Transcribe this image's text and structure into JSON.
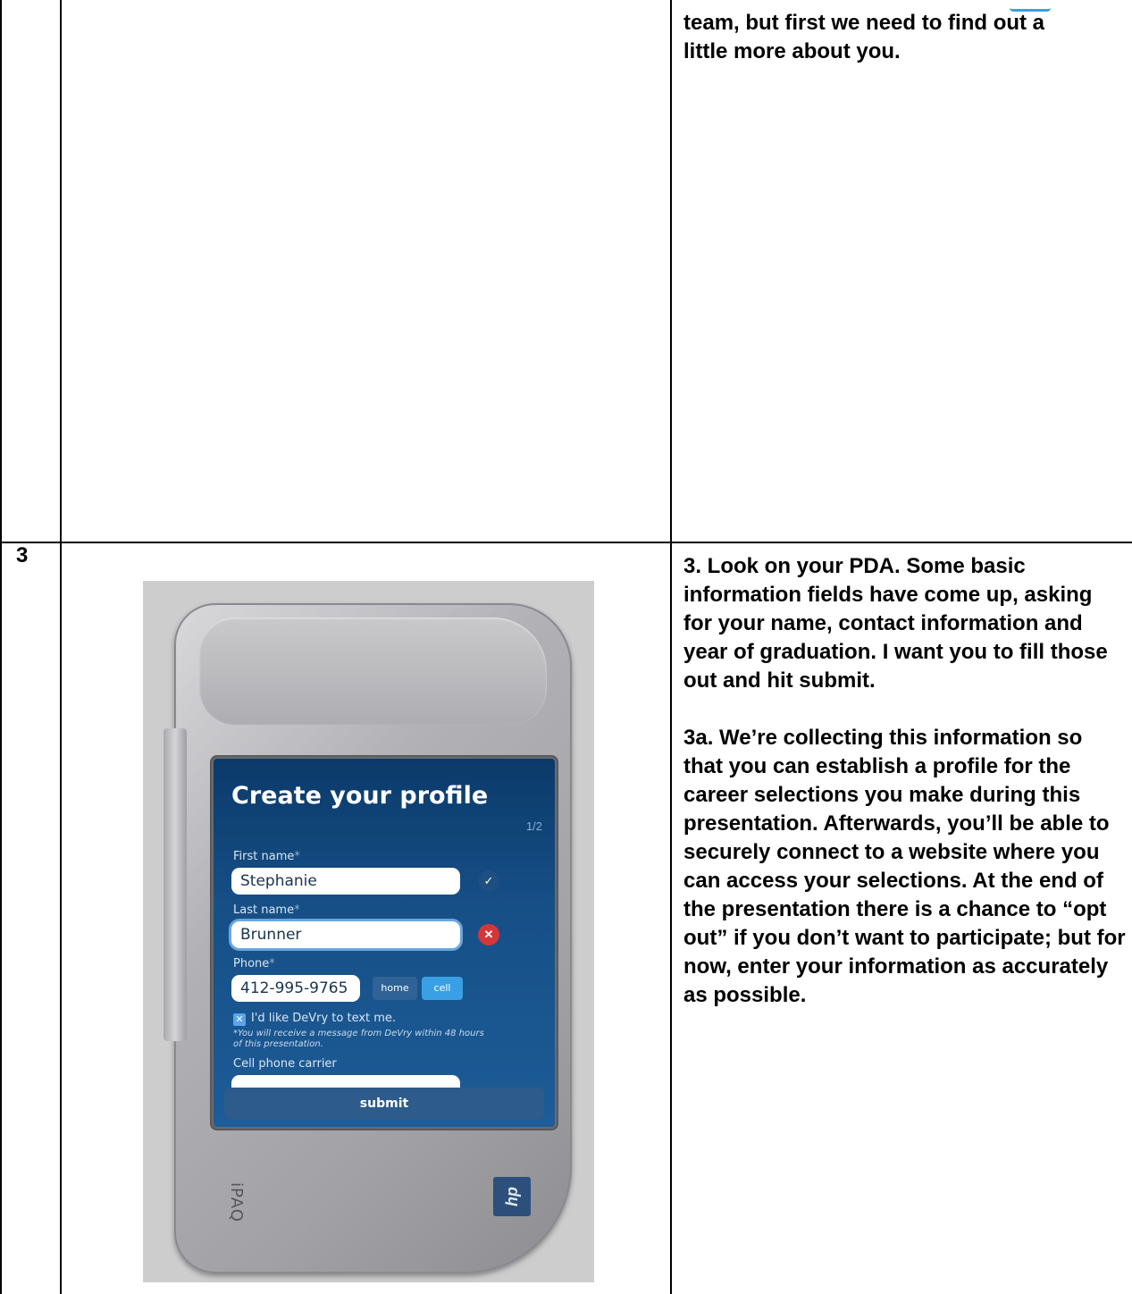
{
  "table": {
    "row2_notes": [
      "team, but first we need to find out a",
      "little more about you."
    ],
    "row3": {
      "step": "3",
      "notes": [
        "3. Look on your PDA. Some basic information fields have come up, asking for your name, contact information and year of graduation. I want you to fill those out and hit submit.",
        "3a. We’re collecting this information so that you can establish a profile for the career selections you make during this presentation. Afterwards, you’ll be able to securely connect to a website where you can access your selections. At the end of the presentation there is a chance to “opt out” if you don’t want to participate; but for now, enter your information as accurately as possible."
      ]
    }
  },
  "pda": {
    "title": "Create your profile",
    "page": "1/2",
    "first_name_label": "First name",
    "first_name_value": "Stephanie",
    "last_name_label": "Last name",
    "last_name_value": "Brunner",
    "phone_label": "Phone",
    "phone_value": "412-995-9765",
    "phone_home": "home",
    "phone_cell": "cell",
    "required_mark": "*",
    "text_me_label": "I'd like DeVry to text me.",
    "text_me_note": "*You will receive a message from DeVry within 48 hours of this presentation.",
    "carrier_label": "Cell phone carrier",
    "carrier_value": "",
    "submit_label": "submit",
    "brand": "iPAQ",
    "logo": "hp"
  }
}
